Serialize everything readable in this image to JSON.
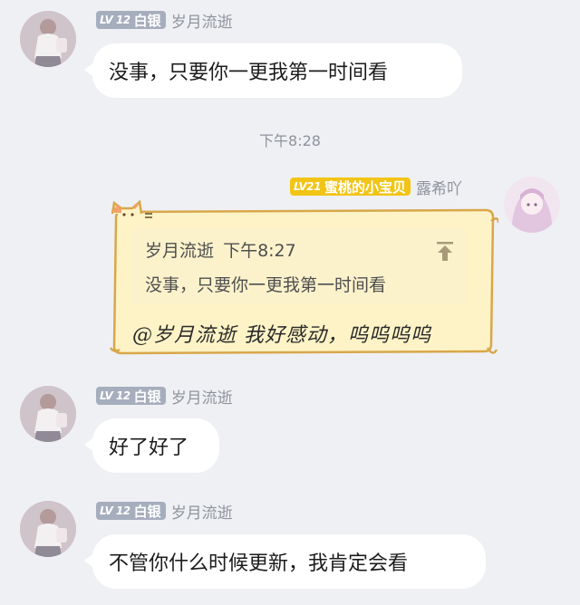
{
  "messages": [
    {
      "level": "LV 12",
      "tier": "白银",
      "sender": "岁月流逝",
      "text": "没事，只要你一更我第一时间看"
    },
    {
      "level": "LV 12",
      "tier": "白银",
      "sender": "岁月流逝",
      "text": "好了好了"
    },
    {
      "level": "LV 12",
      "tier": "白银",
      "sender": "岁月流逝",
      "text": "不管你什么时候更新，我肯定会看"
    }
  ],
  "timestamp": "下午8:28",
  "reply": {
    "level": "LV21",
    "title": "蜜桃的小宝贝",
    "sender": "露希吖",
    "quote_sender": "岁月流逝",
    "quote_time": "下午8:27",
    "quote_text": "没事，只要你一更我第一时间看",
    "text": "@岁月流逝 我好感动，呜呜呜呜"
  },
  "colors": {
    "background": "#eff0f4",
    "badge_gray": "#a6adbd",
    "badge_gold": "#f2c416",
    "bubble_yellow": "#fdf3c6",
    "bubble_outline": "#d8a74a"
  },
  "icons": [
    "jump-to-top-icon",
    "cat-ears-decoration"
  ]
}
